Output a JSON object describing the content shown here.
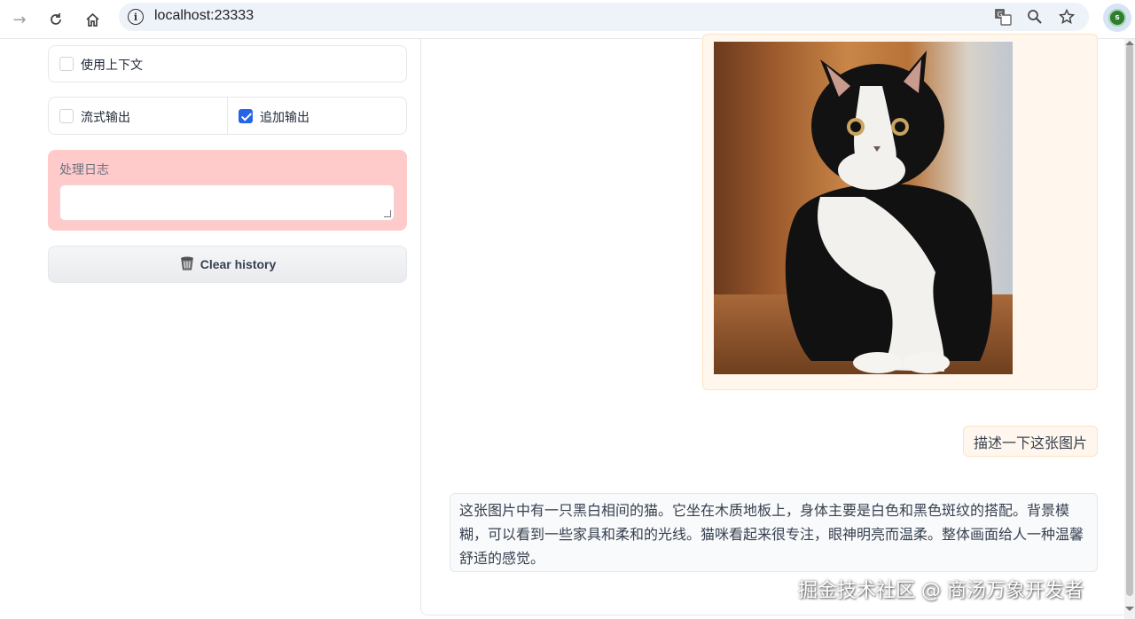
{
  "browser": {
    "url": "localhost:23333",
    "profile_initial": "s"
  },
  "left_panel": {
    "use_context_label": "使用上下文",
    "use_context_checked": false,
    "stream_output_label": "流式输出",
    "stream_output_checked": false,
    "append_output_label": "追加输出",
    "append_output_checked": true,
    "log_label": "处理日志",
    "log_value": "",
    "clear_button_label": "Clear history",
    "clear_button_icon": "trash-icon"
  },
  "chat": {
    "image_alt": "black-and-white cat sitting on wooden floor",
    "user_message": "描述一下这张图片",
    "bot_message": "这张图片中有一只黑白相间的猫。它坐在木质地板上，身体主要是白色和黑色斑纹的搭配。背景模糊，可以看到一些家具和柔和的光线。猫咪看起来很专注，眼神明亮而温柔。整体画面给人一种温馨舒适的感觉。"
  },
  "watermark": "掘金技术社区 @ 商汤万象开发者",
  "colors": {
    "accent": "#2563eb",
    "log_bg": "#fecaca",
    "user_bubble_bg": "#fff7ed"
  }
}
